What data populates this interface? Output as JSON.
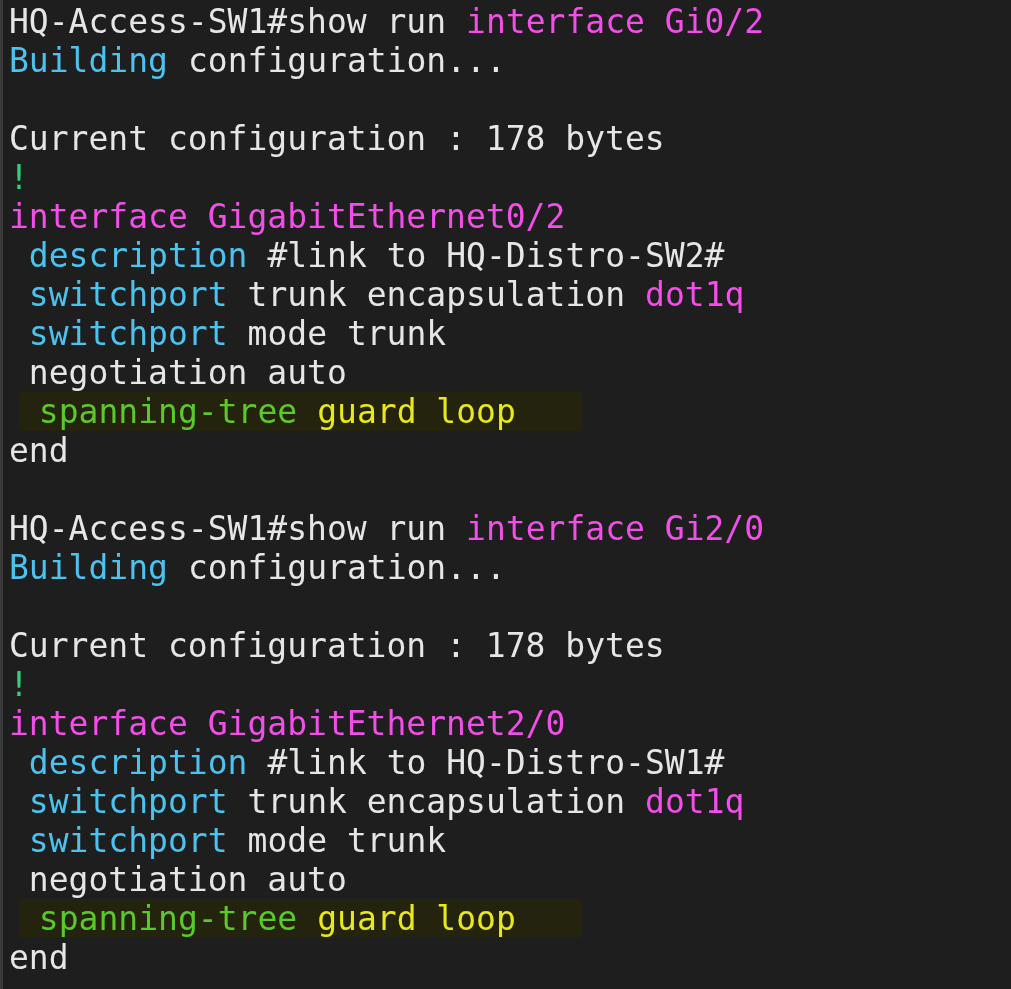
{
  "terminal": {
    "blocks": [
      {
        "lines": [
          {
            "highlighted": false,
            "segments": [
              {
                "text": "HQ-Access-SW1#show run",
                "kind": "plain"
              },
              {
                "text": "interface Gi0/2",
                "kind": "keyword"
              }
            ]
          },
          {
            "highlighted": false,
            "segments": [
              {
                "text": "Building",
                "kind": "command"
              },
              {
                "text": "configuration...",
                "kind": "plain"
              }
            ]
          }
        ]
      },
      {
        "lines": [
          {
            "highlighted": false,
            "segments": [
              {
                "text": "Current configuration : 178 bytes",
                "kind": "plain"
              }
            ]
          },
          {
            "highlighted": false,
            "segments": [
              {
                "text": "!",
                "kind": "bang"
              }
            ]
          },
          {
            "highlighted": false,
            "segments": [
              {
                "text": "interface GigabitEthernet0/2",
                "kind": "keyword"
              }
            ]
          },
          {
            "highlighted": false,
            "segments": [
              {
                "text": " description",
                "kind": "command"
              },
              {
                "text": "#link to HQ-Distro-SW2#",
                "kind": "plain"
              }
            ]
          },
          {
            "highlighted": false,
            "segments": [
              {
                "text": " switchport",
                "kind": "command"
              },
              {
                "text": "trunk encapsulation",
                "kind": "plain"
              },
              {
                "text": "dot1q",
                "kind": "keyword"
              }
            ]
          },
          {
            "highlighted": false,
            "segments": [
              {
                "text": " switchport",
                "kind": "command"
              },
              {
                "text": "mode trunk",
                "kind": "plain"
              }
            ]
          },
          {
            "highlighted": false,
            "segments": [
              {
                "text": " negotiation auto",
                "kind": "plain"
              }
            ]
          },
          {
            "highlighted": true,
            "segments": [
              {
                "text": " spanning-tree",
                "kind": "stp"
              },
              {
                "text": "guard loop",
                "kind": "guard"
              }
            ]
          },
          {
            "highlighted": false,
            "segments": [
              {
                "text": "end",
                "kind": "plain"
              }
            ]
          }
        ]
      },
      {
        "lines": [
          {
            "highlighted": false,
            "segments": [
              {
                "text": "HQ-Access-SW1#show run",
                "kind": "plain"
              },
              {
                "text": "interface Gi2/0",
                "kind": "keyword"
              }
            ]
          },
          {
            "highlighted": false,
            "segments": [
              {
                "text": "Building",
                "kind": "command"
              },
              {
                "text": "configuration...",
                "kind": "plain"
              }
            ]
          }
        ]
      },
      {
        "lines": [
          {
            "highlighted": false,
            "segments": [
              {
                "text": "Current configuration : 178 bytes",
                "kind": "plain"
              }
            ]
          },
          {
            "highlighted": false,
            "segments": [
              {
                "text": "!",
                "kind": "bang"
              }
            ]
          },
          {
            "highlighted": false,
            "segments": [
              {
                "text": "interface GigabitEthernet2/0",
                "kind": "keyword"
              }
            ]
          },
          {
            "highlighted": false,
            "segments": [
              {
                "text": " description",
                "kind": "command"
              },
              {
                "text": "#link to HQ-Distro-SW1#",
                "kind": "plain"
              }
            ]
          },
          {
            "highlighted": false,
            "segments": [
              {
                "text": " switchport",
                "kind": "command"
              },
              {
                "text": "trunk encapsulation",
                "kind": "plain"
              },
              {
                "text": "dot1q",
                "kind": "keyword"
              }
            ]
          },
          {
            "highlighted": false,
            "segments": [
              {
                "text": " switchport",
                "kind": "command"
              },
              {
                "text": "mode trunk",
                "kind": "plain"
              }
            ]
          },
          {
            "highlighted": false,
            "segments": [
              {
                "text": " negotiation auto",
                "kind": "plain"
              }
            ]
          },
          {
            "highlighted": true,
            "segments": [
              {
                "text": " spanning-tree",
                "kind": "stp"
              },
              {
                "text": "guard loop",
                "kind": "guard"
              }
            ]
          },
          {
            "highlighted": false,
            "segments": [
              {
                "text": "end",
                "kind": "plain"
              }
            ]
          }
        ]
      }
    ]
  }
}
